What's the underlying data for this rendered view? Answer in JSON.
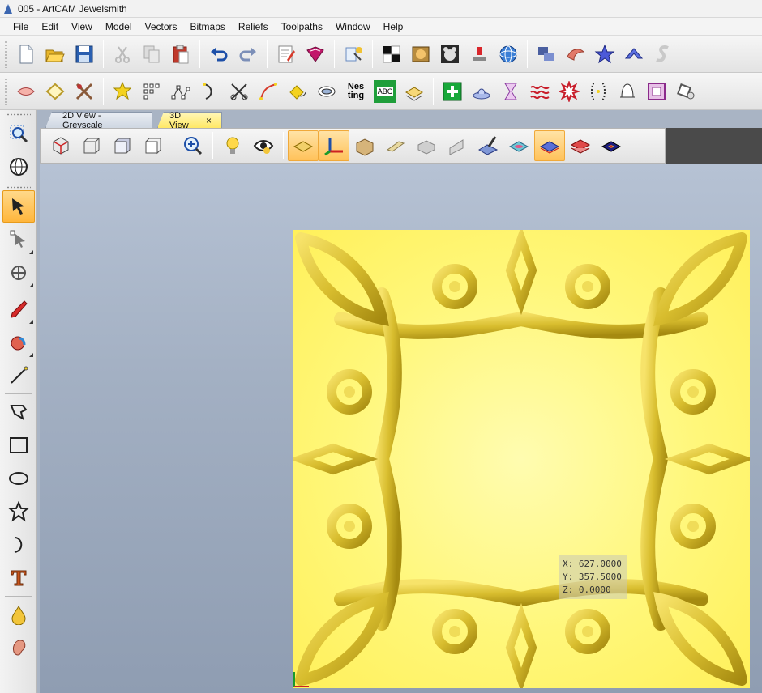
{
  "window": {
    "title": "005 - ArtCAM Jewelsmith"
  },
  "menu": [
    "File",
    "Edit",
    "View",
    "Model",
    "Vectors",
    "Bitmaps",
    "Reliefs",
    "Toolpaths",
    "Window",
    "Help"
  ],
  "toolbar1": {
    "buttons": [
      "new-file-icon",
      "open-folder-icon",
      "save-icon",
      "cut-icon",
      "copy-icon",
      "paste-icon",
      "undo-icon",
      "redo-icon",
      "notes-icon",
      "book-icon",
      "wizard-icon",
      "checker-icon",
      "image-icon",
      "teddy-icon",
      "stamp-icon",
      "sphere-mesh-icon",
      "layers-icon",
      "leaf-icon",
      "star-shape-icon",
      "arrow-shape-icon",
      "s-curve-icon"
    ]
  },
  "toolbar2": {
    "buttons": [
      "ring-icon",
      "gem-outline-icon",
      "tools-icon",
      "select-star-icon",
      "nodes-icon",
      "node-edit-icon",
      "arc-icon",
      "scissors-icon",
      "bezier-icon",
      "flip-shape-icon",
      "offset-icon",
      "nesting-icon",
      "text-grid-icon",
      "layer-stack-icon",
      "add-green-icon",
      "bowl-icon",
      "hourglass-icon",
      "wave-icon",
      "burst-icon",
      "bracket-icon",
      "bell-icon",
      "frame-icon",
      "rotate-icon"
    ],
    "nesting_label": "Nes\nting",
    "text_grid_label": "ABC"
  },
  "left_tools": [
    "zoom-region-icon",
    "globe-icon",
    "select-arrow-icon",
    "node-arrow-icon",
    "transform-icon",
    "pen-icon",
    "paint-brush-icon",
    "line-icon",
    "polyline-icon",
    "rectangle-icon",
    "ellipse-icon",
    "star-icon",
    "arc-icon",
    "text-icon",
    "drop-icon",
    "ear-icon"
  ],
  "tabs": {
    "view2d": "2D View - Greyscale",
    "view3d": "3D View",
    "close": "×"
  },
  "viewbar": {
    "buttons": [
      "iso-view-icon",
      "wire-cube-1-icon",
      "solid-cube-icon",
      "wire-cube-2-icon",
      "zoom-icon",
      "light-icon",
      "eye-icon",
      "plane-icon",
      "axis-icon",
      "box-icon",
      "bar-icon",
      "cube-grey-icon",
      "slab-icon",
      "brush-3d-icon",
      "rainbow-icon",
      "plane-blue-icon",
      "plane-red-icon",
      "plane-dark-icon"
    ]
  },
  "coords": {
    "x": "X: 627.0000",
    "y": "Y: 357.5000",
    "z": "Z: 0.0000"
  },
  "colors": {
    "relief": "#fff77a",
    "frame": "#d8c23a",
    "accent": "#ffb63c"
  }
}
